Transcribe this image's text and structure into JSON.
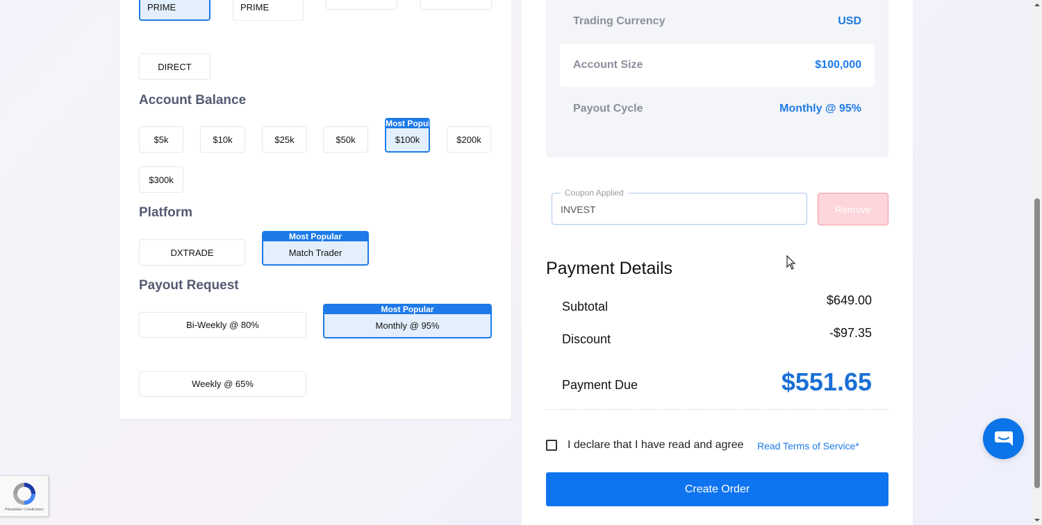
{
  "account_type": {
    "options": [
      "PRIME",
      "PRIME",
      "",
      "",
      "DIRECT"
    ],
    "selected": "PRIME"
  },
  "account_balance": {
    "title": "Account Balance",
    "options": [
      "$5k",
      "$10k",
      "$25k",
      "$50k",
      "$100k",
      "$200k",
      "$300k"
    ],
    "selected": "$100k",
    "badge": "Most Popular"
  },
  "platform": {
    "title": "Platform",
    "options": [
      "DXTRADE",
      "Match Trader"
    ],
    "selected": "Match Trader",
    "badge": "Most Popular"
  },
  "payout_request": {
    "title": "Payout Request",
    "options": [
      "Bi-Weekly @ 80%",
      "Monthly @ 95%",
      "Weekly @ 65%"
    ],
    "selected": "Monthly @ 95%",
    "badge": "Most Popular"
  },
  "summary": {
    "rows": [
      {
        "label": "Trading Currency",
        "value": "USD"
      },
      {
        "label": "Account Size",
        "value": "$100,000"
      },
      {
        "label": "Payout Cycle",
        "value": "Monthly @ 95%"
      }
    ]
  },
  "coupon": {
    "legend": "Coupon Applied",
    "value": "INVEST",
    "remove_label": "Remove"
  },
  "payment": {
    "title": "Payment Details",
    "subtotal_label": "Subtotal",
    "subtotal_value": "$649.00",
    "discount_label": "Discount",
    "discount_value": "-$97.35",
    "due_label": "Payment Due",
    "due_value": "$551.65"
  },
  "agreement": {
    "text": "I declare that I have read and agree",
    "link": "Read Terms of Service*",
    "checked": false
  },
  "create_button": "Create Order",
  "recaptcha": {
    "text": "Privacidad • Condiciones"
  },
  "colors": {
    "accent": "#1d7ae8",
    "button": "#0f74ef",
    "remove_bg": "#fdd5da"
  }
}
